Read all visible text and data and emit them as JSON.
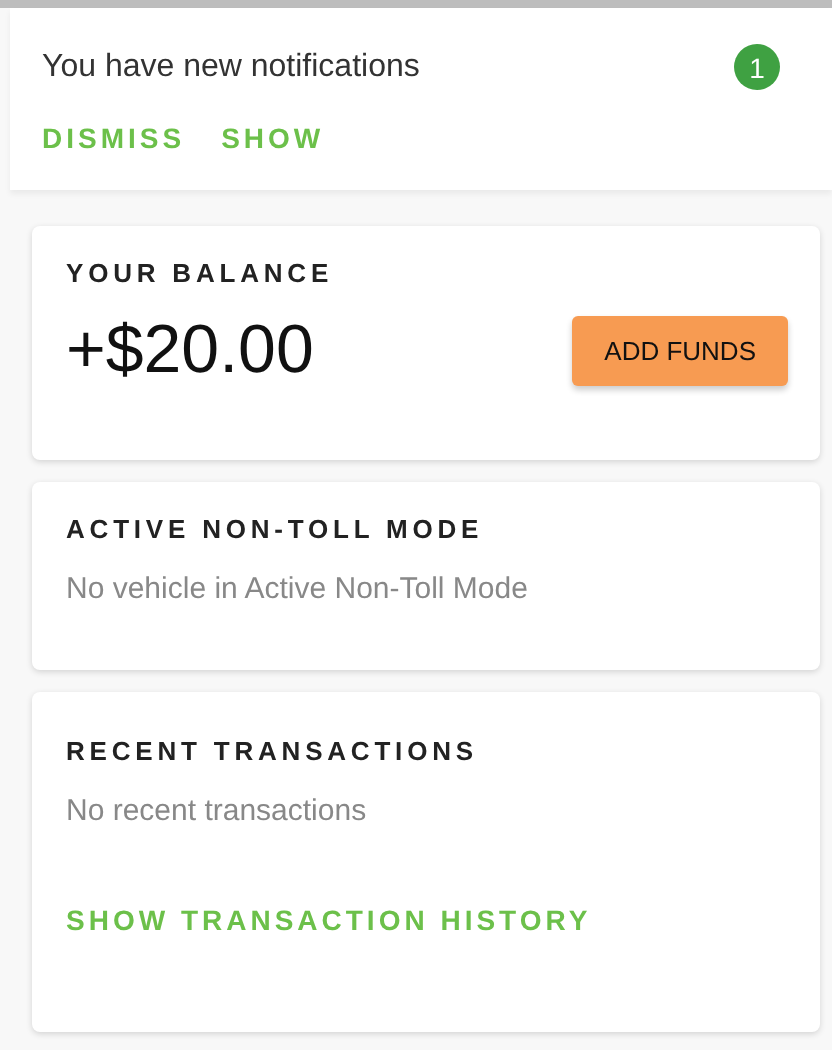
{
  "notification": {
    "message": "You have new notifications",
    "count": "1",
    "actions": [
      "DISMISS",
      "SHOW"
    ]
  },
  "balance": {
    "title": "YOUR BALANCE",
    "amount": "+$20.00",
    "button": "ADD FUNDS"
  },
  "non_toll": {
    "title": "ACTIVE NON-TOLL MODE",
    "text": "No vehicle in Active Non-Toll Mode"
  },
  "transactions": {
    "title": "RECENT TRANSACTIONS",
    "text": "No recent transactions",
    "link": "SHOW TRANSACTION HISTORY"
  }
}
